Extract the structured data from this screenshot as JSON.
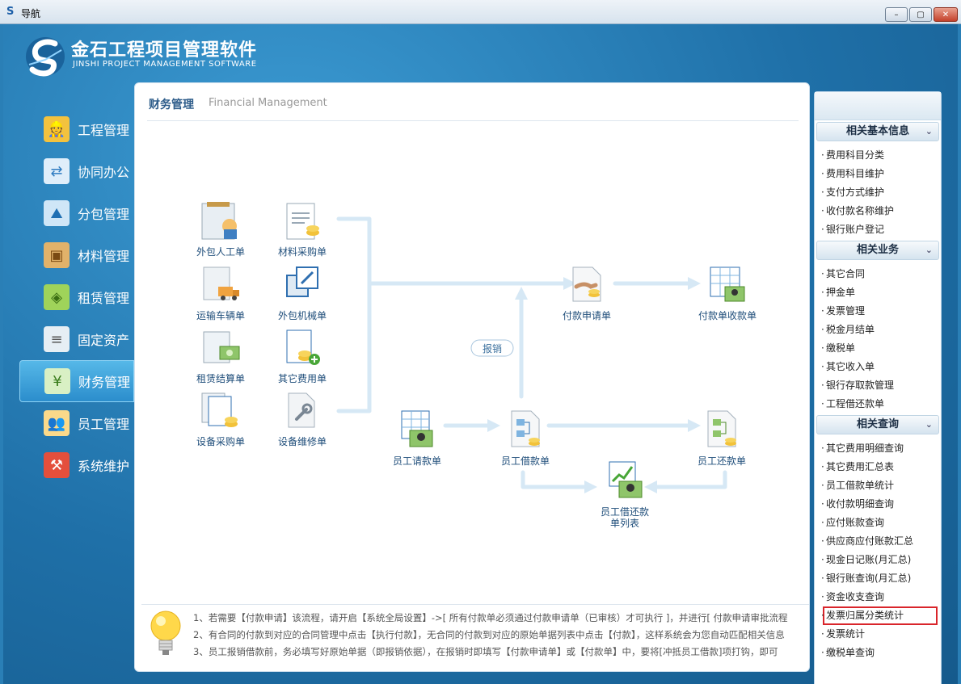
{
  "window": {
    "title": "导航",
    "minimize": "–",
    "restore": "▢",
    "close": "✕"
  },
  "brand": {
    "name_cn": "金石工程项目管理软件",
    "name_en": "JINSHI PROJECT MANAGEMENT SOFTWARE"
  },
  "nav": [
    {
      "label": "工程管理",
      "icon": "engineer-icon"
    },
    {
      "label": "协同办公",
      "icon": "collaboration-icon"
    },
    {
      "label": "分包管理",
      "icon": "subcontract-icon"
    },
    {
      "label": "材料管理",
      "icon": "box-icon"
    },
    {
      "label": "租赁管理",
      "icon": "cubes-icon"
    },
    {
      "label": "固定资产",
      "icon": "server-icon"
    },
    {
      "label": "财务管理",
      "icon": "money-icon",
      "active": true
    },
    {
      "label": "员工管理",
      "icon": "people-icon"
    },
    {
      "label": "系统维护",
      "icon": "tools-icon"
    }
  ],
  "content": {
    "title": "财务管理",
    "title_en": "Financial Management",
    "flow": {
      "outsource_labor": "外包人工单",
      "material_purchase": "材料采购单",
      "transport_vehicle": "运输车辆单",
      "outsource_machine": "外包机械单",
      "lease_settlement": "租赁结算单",
      "other_expense": "其它费用单",
      "equipment_purchase": "设备采购单",
      "equipment_repair": "设备维修单",
      "payment_request": "付款申请单",
      "payment_receipt": "付款单收款单",
      "reimburse": "报销",
      "employee_request": "员工请款单",
      "employee_loan": "员工借款单",
      "employee_repay": "员工还款单",
      "loan_repay_list_1": "员工借还款",
      "loan_repay_list_2": "单列表"
    },
    "tips": [
      "1、若需要【付款申请】该流程，请开启【系统全局设置】->[ 所有付款单必须通过付款申请单（已审核）才可执行 ]，并进行[ 付款申请审批流程",
      "2、有合同的付款到对应的合同管理中点击【执行付款】，无合同的付款到对应的原始单据列表中点击【付款】，这样系统会为您自动匹配相关信息",
      "3、员工报销借款前，务必填写好原始单据（即报销依据），在报销时即填写【付款申请单】或【付款单】中，要将[冲抵员工借款]项打钩，即可"
    ]
  },
  "right_panel": {
    "sections": [
      {
        "title": "相关基本信息",
        "chevron": "⌄",
        "items": [
          "费用科目分类",
          "费用科目维护",
          "支付方式维护",
          "收付款名称维护",
          "银行账户登记"
        ]
      },
      {
        "title": "相关业务",
        "chevron": "⌄",
        "items": [
          "其它合同",
          "押金单",
          "发票管理",
          "税金月结单",
          "缴税单",
          "其它收入单",
          "银行存取款管理",
          "工程借还款单"
        ]
      },
      {
        "title": "相关查询",
        "chevron": "⌄",
        "items": [
          "其它费用明细查询",
          "其它费用汇总表",
          "员工借款单统计",
          "收付款明细查询",
          "应付账款查询",
          "供应商应付账款汇总",
          "现金日记账(月汇总)",
          "银行账查询(月汇总)",
          "资金收支查询",
          "发票归属分类统计",
          "发票统计",
          "缴税单查询"
        ]
      }
    ],
    "highlighted_item": "发票归属分类统计"
  }
}
